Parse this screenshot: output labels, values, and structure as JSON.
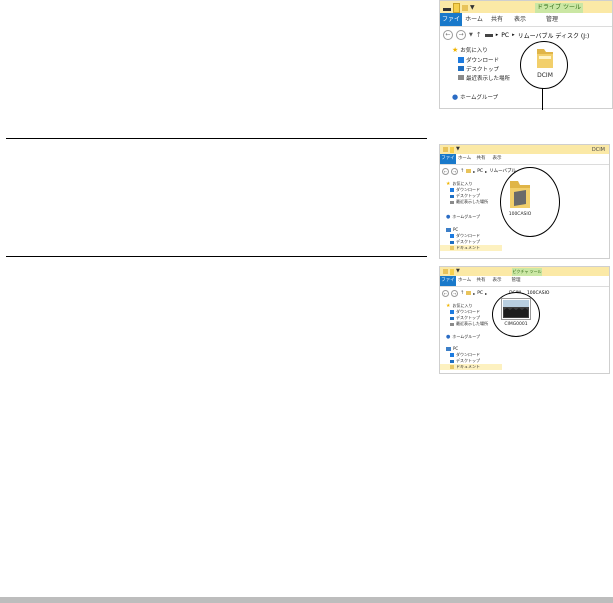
{
  "shot1": {
    "context_tab": "ドライブ ツール",
    "tabs": [
      "ファイル",
      "ホーム",
      "共有",
      "表示",
      "管理"
    ],
    "address": [
      "PC",
      "リムーバブル ディスク (J:)"
    ],
    "nav": {
      "favorites": "お気に入り",
      "downloads": "ダウンロード",
      "desktop": "デスクトップ",
      "recent": "最近表示した場所",
      "homegroup": "ホームグループ"
    },
    "folder": "DCIM"
  },
  "shot2": {
    "title": "DCIM",
    "tabs": [
      "ファイル",
      "ホーム",
      "共有",
      "表示"
    ],
    "address": [
      "PC",
      "リムーバブル",
      "DCIM"
    ],
    "nav": {
      "favorites": "お気に入り",
      "downloads": "ダウンロード",
      "desktop": "デスクトップ",
      "recent": "最近表示した場所",
      "homegroup": "ホームグループ",
      "pc": "PC",
      "pc_downloads": "ダウンロード",
      "pc_desktop": "デスクトップ",
      "pc_documents": "ドキュメント"
    },
    "folder": "100CASIO"
  },
  "shot3": {
    "context_tab": "ピクチャ ツール",
    "tabs": [
      "ファイル",
      "ホーム",
      "共有",
      "表示",
      "管理"
    ],
    "address": [
      "PC",
      "DCIM",
      "100CASIO"
    ],
    "nav": {
      "favorites": "お気に入り",
      "downloads": "ダウンロード",
      "desktop": "デスクトップ",
      "recent": "最近表示した場所",
      "homegroup": "ホームグループ",
      "pc": "PC",
      "pc_downloads": "ダウンロード",
      "pc_desktop": "デスクトップ",
      "pc_documents": "ドキュメント"
    },
    "file": "CIMG0001"
  }
}
